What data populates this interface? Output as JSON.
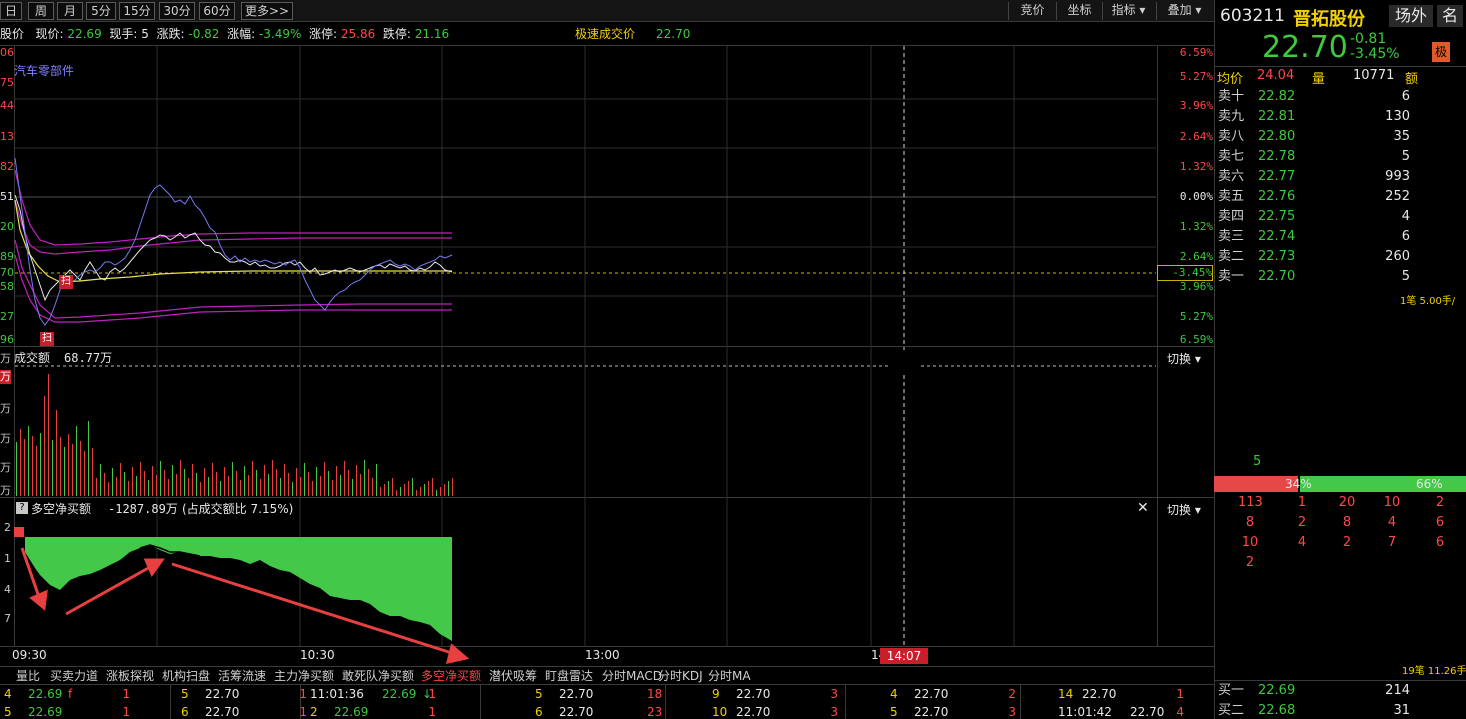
{
  "tabs": {
    "periods": [
      "日",
      "周",
      "月",
      "5分",
      "15分",
      "30分",
      "60分",
      "更多>>"
    ],
    "right": [
      "竞价",
      "坐标",
      "指标 ▾",
      "叠加 ▾"
    ]
  },
  "info": {
    "stock_cut": "股价",
    "price_label": "现价:",
    "price": "22.69",
    "hand_label": "现手:",
    "hand": "5",
    "change_label": "涨跌:",
    "change": "-0.82",
    "pct_label": "涨幅:",
    "pct": "-3.49%",
    "limit_up_label": "涨停:",
    "limit_up": "25.86",
    "limit_down_label": "跌停:",
    "limit_down": "21.16",
    "fast_label": "极速成交价",
    "fast": "22.70"
  },
  "main_chart": {
    "sector_label": "汽车零部件",
    "left_ticks": [
      "06",
      "75",
      "44",
      "13",
      "82",
      "51",
      "20",
      "89",
      "70",
      "58",
      "27",
      "96"
    ],
    "pct_ticks_red": [
      "6.59%",
      "5.27%",
      "3.96%",
      "2.64%",
      "1.32%"
    ],
    "pct_zero": "0.00%",
    "pct_ticks_green": [
      "1.32%",
      "2.64%",
      "3.96%",
      "5.27%",
      "6.59%"
    ],
    "current_pct_box": "-3.45%",
    "marker": "扫"
  },
  "volume_panel": {
    "title": "成交额",
    "value": "68.77万",
    "switch": "切换 ▾",
    "left_ticks": [
      "万",
      "万",
      "万",
      "万",
      "万",
      "万"
    ]
  },
  "net_panel": {
    "help": "?",
    "title": "多空净买额",
    "value": "-1287.89万",
    "ratio": "(占成交额比 7.15%)",
    "switch": "切换 ▾",
    "close": "✕",
    "left_ticks": [
      "2",
      "1",
      "4",
      "7"
    ]
  },
  "time_axis": {
    "t1": "09:30",
    "t2": "10:30",
    "t3": "13:00",
    "t4": "14",
    "cursor_time": "14:07"
  },
  "bottom_tabs": [
    "量比",
    "买卖力道",
    "涨板探视",
    "机构扫盘",
    "活筹流速",
    "主力净买额",
    "敢死队净买额",
    "多空净买额",
    "潜伏吸筹",
    "盯盘雷达",
    "分时MACD",
    "分时KDJ",
    "分时MA"
  ],
  "active_tab_index": 7,
  "ticker": {
    "row1": [
      [
        "4",
        "22.69",
        "f",
        "1"
      ],
      [
        "5",
        "22.70",
        "",
        "1"
      ],
      [
        "11:01:36",
        "22.69",
        "↓",
        "1"
      ],
      [
        "5",
        "22.70",
        "",
        "18"
      ],
      [
        "9",
        "22.70",
        "",
        "3"
      ],
      [
        "4",
        "22.70",
        "",
        "2"
      ],
      [
        "14",
        "22.70",
        "",
        "1"
      ]
    ],
    "row2": [
      [
        "5",
        "22.69",
        "",
        "1"
      ],
      [
        "6",
        "22.70",
        "",
        "1"
      ],
      [
        "2",
        "22.69",
        "",
        "1"
      ],
      [
        "6",
        "22.70",
        "",
        "23"
      ],
      [
        "10",
        "22.70",
        "",
        "3"
      ],
      [
        "5",
        "22.70",
        "",
        "3"
      ],
      [
        "11:01:42",
        "22.70",
        "",
        "4"
      ]
    ]
  },
  "stock": {
    "code": "603211",
    "name": "晋拓股份",
    "btn_outside": "场外",
    "btn_name": "名",
    "price": "22.70",
    "change": "-0.81",
    "pct": "-3.45%",
    "badge": "极",
    "avg_label": "均价",
    "avg": "24.04",
    "vol_label": "量",
    "vol": "10771",
    "amt_label": "额"
  },
  "order_book": {
    "sells": [
      {
        "label": "卖十",
        "price": "22.82",
        "vol": "6"
      },
      {
        "label": "卖九",
        "price": "22.81",
        "vol": "130"
      },
      {
        "label": "卖八",
        "price": "22.80",
        "vol": "35"
      },
      {
        "label": "卖七",
        "price": "22.78",
        "vol": "5"
      },
      {
        "label": "卖六",
        "price": "22.77",
        "vol": "993"
      },
      {
        "label": "卖五",
        "price": "22.76",
        "vol": "252"
      },
      {
        "label": "卖四",
        "price": "22.75",
        "vol": "4"
      },
      {
        "label": "卖三",
        "price": "22.74",
        "vol": "6"
      },
      {
        "label": "卖二",
        "price": "22.73",
        "vol": "260"
      },
      {
        "label": "卖一",
        "price": "22.70",
        "vol": "5"
      }
    ],
    "note1": "1笔 5.00手/",
    "queue_count": "5",
    "bar_left": "34%",
    "bar_right": "66%",
    "bar_left_pct": 34,
    "queue_rows": [
      [
        "113",
        "1",
        "20",
        "10",
        "2"
      ],
      [
        "8",
        "2",
        "8",
        "4",
        "6"
      ],
      [
        "10",
        "4",
        "2",
        "7",
        "6"
      ],
      [
        "2",
        "",
        "",
        "",
        ""
      ]
    ],
    "note2": "19笔 11.26手",
    "buys": [
      {
        "label": "买一",
        "price": "22.69",
        "vol": "214"
      },
      {
        "label": "买二",
        "price": "22.68",
        "vol": "31"
      }
    ]
  }
}
